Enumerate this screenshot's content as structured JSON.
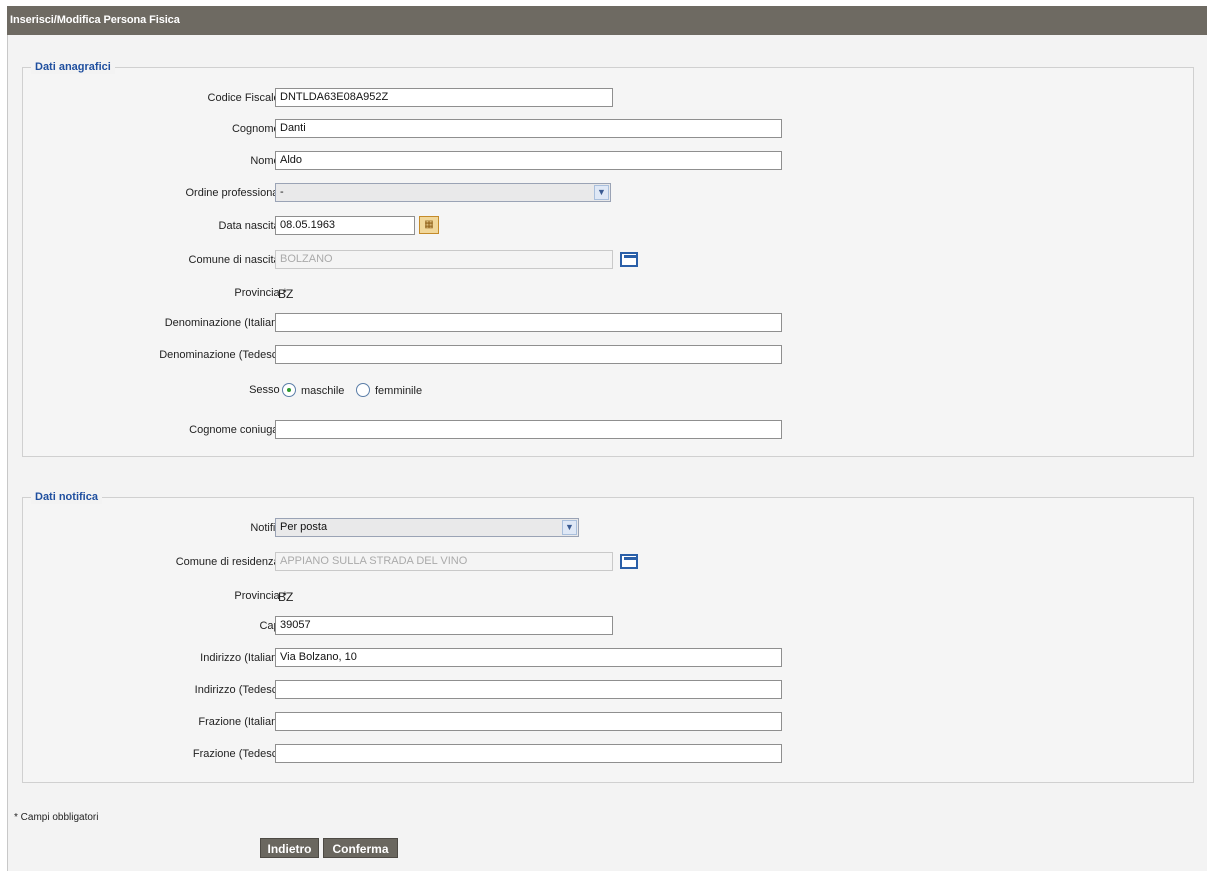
{
  "title": "Inserisci/Modifica Persona Fisica",
  "anagrafici": {
    "legend": "Dati anagrafici",
    "codice_fiscale": {
      "label": "Codice Fiscale *",
      "value": "DNTLDA63E08A952Z"
    },
    "cognome": {
      "label": "Cognome *",
      "value": "Danti"
    },
    "nome": {
      "label": "Nome *",
      "value": "Aldo"
    },
    "ordine": {
      "label": "Ordine professionale",
      "value": "-"
    },
    "data_nascita": {
      "label": "Data nascita *",
      "value": "08.05.1963"
    },
    "comune_nascita": {
      "label": "Comune di nascita *",
      "value": "BOLZANO"
    },
    "provincia": {
      "label": "Provincia *",
      "value": "BZ"
    },
    "denom_it": {
      "label": "Denominazione (Italiano)",
      "value": ""
    },
    "denom_de": {
      "label": "Denominazione (Tedesco)",
      "value": ""
    },
    "sesso": {
      "label": "Sesso *",
      "option_m": "maschile",
      "option_f": "femminile",
      "selected": "maschile"
    },
    "cognome_coniugale": {
      "label": "Cognome coniugale",
      "value": ""
    }
  },
  "notifica": {
    "legend": "Dati notifica",
    "notifica": {
      "label": "Notifica",
      "value": "Per posta"
    },
    "comune_residenza": {
      "label": "Comune di residenza *",
      "value": "APPIANO SULLA STRADA DEL VINO"
    },
    "provincia": {
      "label": "Provincia *",
      "value": "BZ"
    },
    "cap": {
      "label": "Cap *",
      "value": "39057"
    },
    "indirizzo_it": {
      "label": "Indirizzo (Italiano)",
      "value": "Via Bolzano, 10"
    },
    "indirizzo_de": {
      "label": "Indirizzo (Tedesco)",
      "value": ""
    },
    "frazione_it": {
      "label": "Frazione (Italiano)",
      "value": ""
    },
    "frazione_de": {
      "label": "Frazione (Tedesco)",
      "value": ""
    }
  },
  "note": "* Campi obbligatori",
  "buttons": {
    "back": "Indietro",
    "confirm": "Conferma"
  },
  "colors": {
    "titlebar": "#6e6a62",
    "legend": "#1f4f9f",
    "button": "#6a675f"
  }
}
